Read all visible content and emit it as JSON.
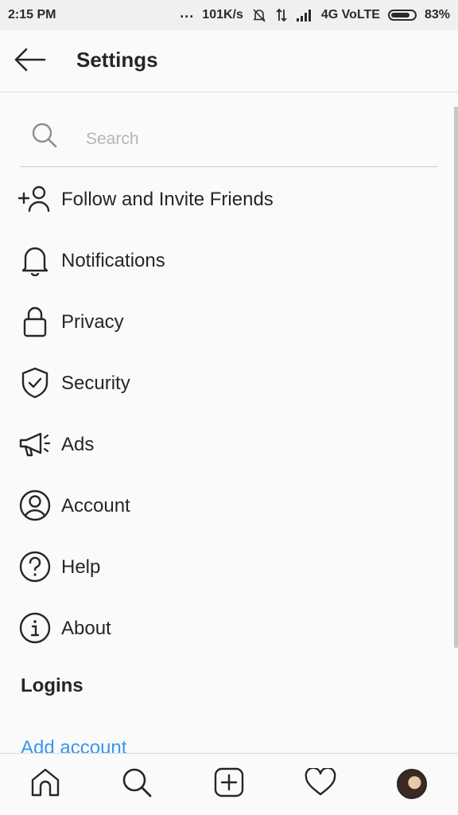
{
  "status_bar": {
    "time": "2:15 PM",
    "dots": "...",
    "speed": "101K/s",
    "network": "4G VoLTE",
    "battery_pct": "83%",
    "battery_level": 0.83
  },
  "header": {
    "title": "Settings",
    "back_icon": "arrow-left-icon"
  },
  "search": {
    "placeholder": "Search",
    "value": ""
  },
  "menu": [
    {
      "label": "Follow and Invite Friends",
      "icon": "add-person-icon"
    },
    {
      "label": "Notifications",
      "icon": "bell-icon"
    },
    {
      "label": "Privacy",
      "icon": "lock-icon"
    },
    {
      "label": "Security",
      "icon": "shield-check-icon"
    },
    {
      "label": "Ads",
      "icon": "megaphone-icon"
    },
    {
      "label": "Account",
      "icon": "user-circle-icon"
    },
    {
      "label": "Help",
      "icon": "help-circle-icon"
    },
    {
      "label": "About",
      "icon": "info-circle-icon"
    }
  ],
  "logins": {
    "section_title": "Logins",
    "add_account": "Add account"
  },
  "bottom_nav": [
    {
      "icon": "home-icon"
    },
    {
      "icon": "search-icon"
    },
    {
      "icon": "add-post-icon"
    },
    {
      "icon": "heart-icon"
    },
    {
      "icon": "profile-avatar"
    }
  ],
  "colors": {
    "link": "#3897f0",
    "text": "#262626",
    "background": "#fafafa"
  }
}
